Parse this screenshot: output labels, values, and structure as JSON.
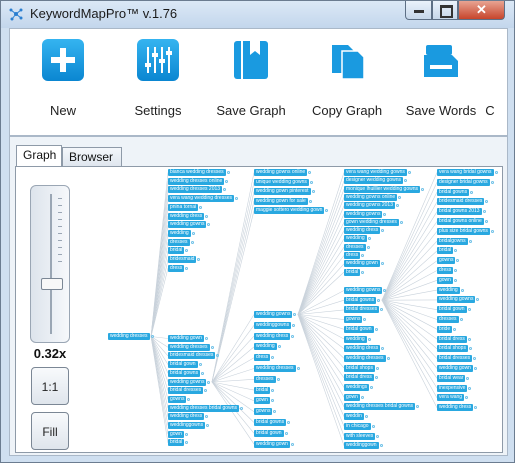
{
  "window": {
    "title": "KeywordMapPro™ v.1.76",
    "minimize_glyph": "─",
    "maximize_glyph": "□",
    "close_glyph": "✕"
  },
  "toolbar": {
    "items": [
      {
        "label": "New",
        "icon": "plus-icon"
      },
      {
        "label": "Settings",
        "icon": "sliders-icon"
      },
      {
        "label": "Save Graph",
        "icon": "bookmark-book-icon"
      },
      {
        "label": "Copy Graph",
        "icon": "copy-icon"
      },
      {
        "label": "Save Words",
        "icon": "save-stack-icon"
      },
      {
        "label": "C",
        "icon": "partial-icon"
      }
    ]
  },
  "tabs": [
    {
      "label": "Graph",
      "active": true
    },
    {
      "label": "Browser",
      "active": false
    }
  ],
  "zoom": {
    "label": "0.32x",
    "reset_label": "1:1",
    "fill_label": "Fill",
    "level": 0.32
  },
  "graph": {
    "root": "wedding dresses",
    "col1": [
      "bianca wedding dresses",
      "wedding dresses online",
      "wedding dresses 2013",
      "vera wang wedding dresses",
      "pnina tornai",
      "wedding dress",
      "wedding gowns",
      "wedding",
      "dresses",
      "bridal",
      "bridesmaid",
      "dress"
    ],
    "col2": [
      "wedding gown",
      "wedding dresses",
      "bridesmaid dresses",
      "bridal gown",
      "bridal gowns",
      "wedding gowns",
      "bridal dresses",
      "gowns",
      "wedding dresses bridal gowns",
      "wedding dress",
      "weddinggowns",
      "gown",
      "bridal"
    ],
    "col3a": [
      "wedding gowns online",
      "unique wedding gowns",
      "wedding gown pinterest",
      "wedding gown for sale",
      "maggie sottero wedding gown"
    ],
    "col3b": [
      "wedding gowns",
      "weddinggowns",
      "wedding dress",
      "wedding",
      "dress",
      "wedding dresses",
      "dresses",
      "bridal",
      "gown",
      "gowns",
      "bridal gowns",
      "bridal gown",
      "wedding gown"
    ],
    "col4a": [
      "vera wang wedding gowns",
      "designer wedding gowns",
      "monique lhuillier wedding gowns",
      "wedding gowns online",
      "wedding gowns 2013",
      "wedding gowns",
      "gown wedding dresses",
      "wedding dress",
      "wedding",
      "dresses",
      "dress",
      "wedding gown",
      "bridal"
    ],
    "col4b": [
      "wedding gowns",
      "bridal gowns",
      "bridal dresses",
      "gowns",
      "bridal gown",
      "wedding",
      "wedding dress",
      "wedding dresses",
      "bridal shops",
      "bridal dress",
      "weddings",
      "gown",
      "wedding dresses bridal gowns",
      "weddin",
      "in chicago",
      "with sleeves",
      "weddinggown"
    ],
    "col5": [
      "vera wang bridal gowns",
      "designer bridal gowns",
      "bridal gowns",
      "bridesmaid dresses",
      "bridal gowns 2013",
      "bridal gowns online",
      "plus size bridal gowns",
      "bridalgowns",
      "bridal",
      "gowns",
      "dress",
      "gown",
      "wedding",
      "wedding gowns",
      "bridal gown",
      "dresses",
      "bride",
      "bridal dress",
      "bridal shops",
      "bridal dresses",
      "wedding gown",
      "bridal wear",
      "inexpensive",
      "vera wang",
      "wedding dress"
    ]
  }
}
